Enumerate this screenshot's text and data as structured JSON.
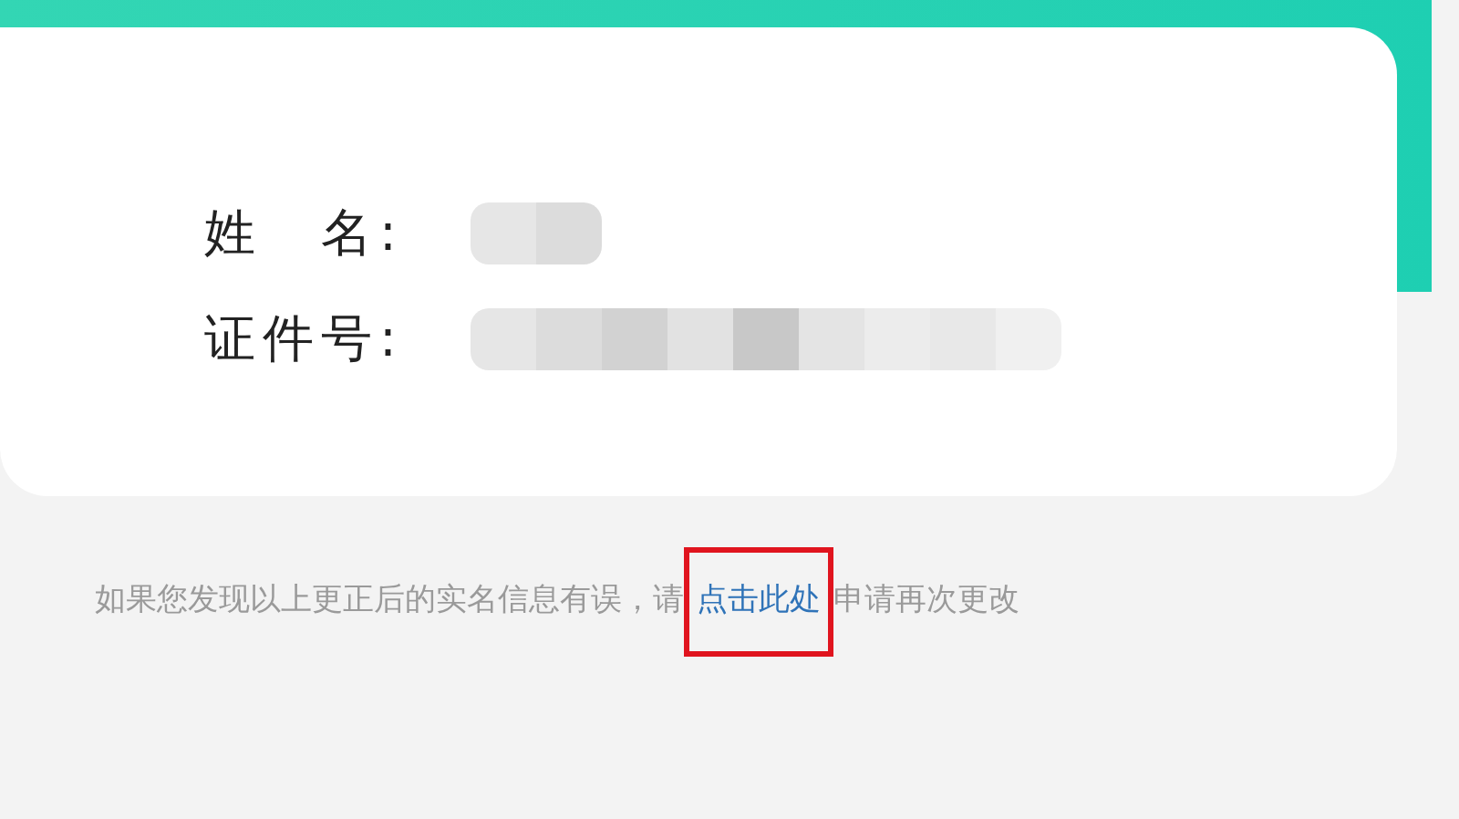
{
  "form": {
    "fields": [
      {
        "label": "姓　名:",
        "redacted": true
      },
      {
        "label": "证件号:",
        "redacted": true
      }
    ]
  },
  "notice": {
    "text_before": "如果您发现以上更正后的实名信息有误，请",
    "link": "点击此处",
    "text_after": "申请再次更改",
    "link_highlighted": true
  }
}
